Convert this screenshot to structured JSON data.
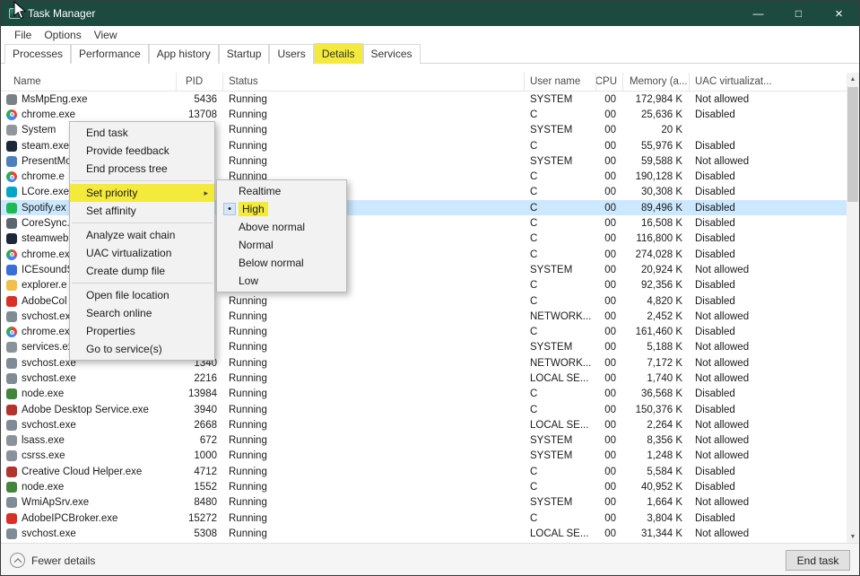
{
  "colors": {
    "titlebar": "#1d4a3e",
    "selection": "#cbe8ff",
    "annotation_highlight": "#f3ea3b"
  },
  "window": {
    "title": "Task Manager",
    "minimize": "—",
    "maximize": "□",
    "close": "×"
  },
  "menubar": {
    "items": [
      "File",
      "Options",
      "View"
    ]
  },
  "tabs": {
    "items": [
      "Processes",
      "Performance",
      "App history",
      "Startup",
      "Users",
      "Details",
      "Services"
    ],
    "active": "Details"
  },
  "columns": {
    "name": "Name",
    "pid": "PID",
    "status": "Status",
    "user": "User name",
    "cpu": "CPU",
    "memory": "Memory (a...",
    "uac": "UAC virtualizat..."
  },
  "rows": [
    {
      "icon": "#7a8288",
      "name": "MsMpEng.exe",
      "pid": "5436",
      "status": "Running",
      "user": "SYSTEM",
      "cpu": "00",
      "memory": "172,984 K",
      "uac": "Not allowed"
    },
    {
      "icon": "chrome",
      "name": "chrome.exe",
      "pid": "13708",
      "status": "Running",
      "user": "C",
      "cpu": "00",
      "memory": "25,636 K",
      "uac": "Disabled"
    },
    {
      "icon": "#8f969c",
      "name": "System",
      "pid": "",
      "status": "Running",
      "user": "SYSTEM",
      "cpu": "00",
      "memory": "20 K",
      "uac": ""
    },
    {
      "icon": "#1b2838",
      "name": "steam.exe",
      "pid": "",
      "status": "Running",
      "user": "C",
      "cpu": "00",
      "memory": "55,976 K",
      "uac": "Disabled"
    },
    {
      "icon": "#4d7fbe",
      "name": "PresentMo",
      "pid": "",
      "status": "Running",
      "user": "SYSTEM",
      "cpu": "00",
      "memory": "59,588 K",
      "uac": "Not allowed"
    },
    {
      "icon": "chrome",
      "name": "chrome.e",
      "pid": "",
      "status": "Running",
      "user": "C",
      "cpu": "00",
      "memory": "190,128 K",
      "uac": "Disabled"
    },
    {
      "icon": "#00a6c8",
      "name": "LCore.exe",
      "pid": "",
      "status": "Running",
      "user": "C",
      "cpu": "00",
      "memory": "30,308 K",
      "uac": "Disabled"
    },
    {
      "icon": "#1db954",
      "name": "Spotify.ex",
      "pid": "",
      "status": "Running",
      "user": "C",
      "cpu": "00",
      "memory": "89,496 K",
      "uac": "Disabled",
      "selected": true
    },
    {
      "icon": "#5c6670",
      "name": "CoreSync.",
      "pid": "",
      "status": "Running",
      "user": "C",
      "cpu": "00",
      "memory": "16,508 K",
      "uac": "Disabled"
    },
    {
      "icon": "#1b2838",
      "name": "steamweb",
      "pid": "",
      "status": "Running",
      "user": "C",
      "cpu": "00",
      "memory": "116,800 K",
      "uac": "Disabled"
    },
    {
      "icon": "chrome",
      "name": "chrome.ex",
      "pid": "",
      "status": "Running",
      "user": "C",
      "cpu": "00",
      "memory": "274,028 K",
      "uac": "Disabled"
    },
    {
      "icon": "#3a6fd8",
      "name": "ICEsoundS",
      "pid": "",
      "status": "Running",
      "user": "SYSTEM",
      "cpu": "00",
      "memory": "20,924 K",
      "uac": "Not allowed"
    },
    {
      "icon": "#f0c04a",
      "name": "explorer.e",
      "pid": "",
      "status": "Running",
      "user": "C",
      "cpu": "00",
      "memory": "92,356 K",
      "uac": "Disabled"
    },
    {
      "icon": "#d93025",
      "name": "AdobeCol",
      "pid": "",
      "status": "Running",
      "user": "C",
      "cpu": "00",
      "memory": "4,820 K",
      "uac": "Disabled"
    },
    {
      "icon": "#7f8b95",
      "name": "svchost.ex",
      "pid": "",
      "status": "Running",
      "user": "NETWORK...",
      "cpu": "00",
      "memory": "2,452 K",
      "uac": "Not allowed"
    },
    {
      "icon": "chrome",
      "name": "chrome.ex",
      "pid": "",
      "status": "Running",
      "user": "C",
      "cpu": "00",
      "memory": "161,460 K",
      "uac": "Disabled"
    },
    {
      "icon": "#8a939b",
      "name": "services.ex",
      "pid": "",
      "status": "Running",
      "user": "SYSTEM",
      "cpu": "00",
      "memory": "5,188 K",
      "uac": "Not allowed"
    },
    {
      "icon": "#7f8b95",
      "name": "svchost.exe",
      "pid": "1340",
      "status": "Running",
      "user": "NETWORK...",
      "cpu": "00",
      "memory": "7,172 K",
      "uac": "Not allowed"
    },
    {
      "icon": "#7f8b95",
      "name": "svchost.exe",
      "pid": "2216",
      "status": "Running",
      "user": "LOCAL SE...",
      "cpu": "00",
      "memory": "1,740 K",
      "uac": "Not allowed"
    },
    {
      "icon": "#43853d",
      "name": "node.exe",
      "pid": "13984",
      "status": "Running",
      "user": "C",
      "cpu": "00",
      "memory": "36,568 K",
      "uac": "Disabled"
    },
    {
      "icon": "#b3342e",
      "name": "Adobe Desktop Service.exe",
      "pid": "3940",
      "status": "Running",
      "user": "C",
      "cpu": "00",
      "memory": "150,376 K",
      "uac": "Disabled"
    },
    {
      "icon": "#7f8b95",
      "name": "svchost.exe",
      "pid": "2668",
      "status": "Running",
      "user": "LOCAL SE...",
      "cpu": "00",
      "memory": "2,264 K",
      "uac": "Not allowed"
    },
    {
      "icon": "#8a939b",
      "name": "lsass.exe",
      "pid": "672",
      "status": "Running",
      "user": "SYSTEM",
      "cpu": "00",
      "memory": "8,356 K",
      "uac": "Not allowed"
    },
    {
      "icon": "#8a939b",
      "name": "csrss.exe",
      "pid": "1000",
      "status": "Running",
      "user": "SYSTEM",
      "cpu": "00",
      "memory": "1,248 K",
      "uac": "Not allowed"
    },
    {
      "icon": "#b3342e",
      "name": "Creative Cloud Helper.exe",
      "pid": "4712",
      "status": "Running",
      "user": "C",
      "cpu": "00",
      "memory": "5,584 K",
      "uac": "Disabled"
    },
    {
      "icon": "#43853d",
      "name": "node.exe",
      "pid": "1552",
      "status": "Running",
      "user": "C",
      "cpu": "00",
      "memory": "40,952 K",
      "uac": "Disabled"
    },
    {
      "icon": "#7f8b95",
      "name": "WmiApSrv.exe",
      "pid": "8480",
      "status": "Running",
      "user": "SYSTEM",
      "cpu": "00",
      "memory": "1,664 K",
      "uac": "Not allowed"
    },
    {
      "icon": "#d93025",
      "name": "AdobeIPCBroker.exe",
      "pid": "15272",
      "status": "Running",
      "user": "C",
      "cpu": "00",
      "memory": "3,804 K",
      "uac": "Disabled"
    },
    {
      "icon": "#7f8b95",
      "name": "svchost.exe",
      "pid": "5308",
      "status": "Running",
      "user": "LOCAL SE...",
      "cpu": "00",
      "memory": "31,344 K",
      "uac": "Not allowed"
    }
  ],
  "context_menu": {
    "items": [
      {
        "label": "End task"
      },
      {
        "label": "Provide feedback"
      },
      {
        "label": "End process tree",
        "sep_after": true
      },
      {
        "label": "Set priority",
        "submenu": true,
        "highlight": true
      },
      {
        "label": "Set affinity",
        "sep_after": true
      },
      {
        "label": "Analyze wait chain"
      },
      {
        "label": "UAC virtualization"
      },
      {
        "label": "Create dump file",
        "sep_after": true
      },
      {
        "label": "Open file location"
      },
      {
        "label": "Search online"
      },
      {
        "label": "Properties"
      },
      {
        "label": "Go to service(s)"
      }
    ]
  },
  "priority_submenu": {
    "items": [
      {
        "label": "Realtime"
      },
      {
        "label": "High",
        "selected": true,
        "highlight": true
      },
      {
        "label": "Above normal"
      },
      {
        "label": "Normal"
      },
      {
        "label": "Below normal"
      },
      {
        "label": "Low"
      }
    ]
  },
  "footer": {
    "fewer_details": "Fewer details",
    "end_task": "End task"
  }
}
